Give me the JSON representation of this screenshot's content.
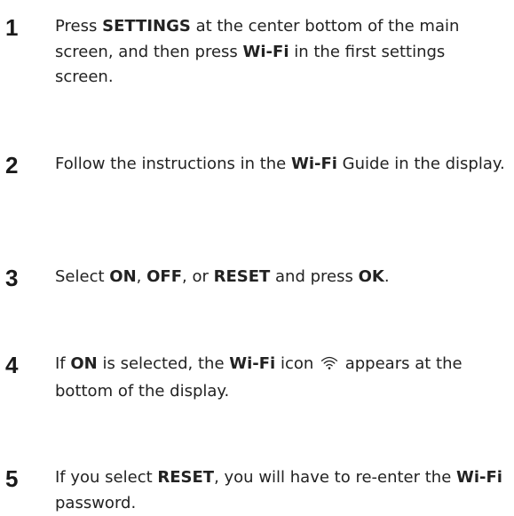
{
  "steps": [
    {
      "number": "1",
      "parts": [
        {
          "text": "Press ",
          "bold": false
        },
        {
          "text": "SETTINGS",
          "bold": true
        },
        {
          "text": " at the center bottom of the main screen, and then press ",
          "bold": false
        },
        {
          "text": "Wi-Fi",
          "bold": true
        },
        {
          "text": " in the first settings screen.",
          "bold": false
        }
      ]
    },
    {
      "number": "2",
      "parts": [
        {
          "text": "Follow the instructions in the ",
          "bold": false
        },
        {
          "text": "Wi-Fi",
          "bold": true
        },
        {
          "text": " Guide in the display.",
          "bold": false
        }
      ]
    },
    {
      "number": "3",
      "parts": [
        {
          "text": "Select ",
          "bold": false
        },
        {
          "text": "ON",
          "bold": true
        },
        {
          "text": ", ",
          "bold": false
        },
        {
          "text": "OFF",
          "bold": true
        },
        {
          "text": ", or ",
          "bold": false
        },
        {
          "text": "RESET",
          "bold": true
        },
        {
          "text": " and press ",
          "bold": false
        },
        {
          "text": "OK",
          "bold": true
        },
        {
          "text": ".",
          "bold": false
        }
      ]
    },
    {
      "number": "4",
      "parts": [
        {
          "text": "If ",
          "bold": false
        },
        {
          "text": "ON",
          "bold": true
        },
        {
          "text": " is selected, the ",
          "bold": false
        },
        {
          "text": "Wi-Fi",
          "bold": true
        },
        {
          "text": " icon ",
          "bold": false
        },
        {
          "icon": "wifi-icon"
        },
        {
          "text": " appears at the bottom of the display.",
          "bold": false
        }
      ]
    },
    {
      "number": "5",
      "parts": [
        {
          "text": "If you select ",
          "bold": false
        },
        {
          "text": "RESET",
          "bold": true
        },
        {
          "text": ", you will have to re-enter the ",
          "bold": false
        },
        {
          "text": "Wi-Fi",
          "bold": true
        },
        {
          "text": " password.",
          "bold": false
        }
      ]
    }
  ]
}
